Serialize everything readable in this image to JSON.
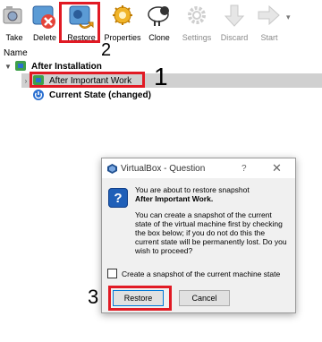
{
  "toolbar": {
    "buttons": [
      {
        "label": "Take",
        "icon": "take-snapshot-icon",
        "enabled": true
      },
      {
        "label": "Delete",
        "icon": "delete-snapshot-icon",
        "enabled": true
      },
      {
        "label": "Restore",
        "icon": "restore-snapshot-icon",
        "enabled": true
      },
      {
        "label": "Properties",
        "icon": "properties-icon",
        "enabled": true
      },
      {
        "label": "Clone",
        "icon": "clone-sheep-icon",
        "enabled": true
      },
      {
        "label": "Settings",
        "icon": "settings-gear-icon",
        "enabled": false
      },
      {
        "label": "Discard",
        "icon": "discard-arrow-icon",
        "enabled": false
      },
      {
        "label": "Start",
        "icon": "start-arrow-icon",
        "enabled": false
      }
    ]
  },
  "tree": {
    "column_header": "Name",
    "root": {
      "label": "After Installation",
      "expanded": true
    },
    "child": {
      "label": "After Important Work",
      "selected": true
    },
    "current_state": {
      "label": "Current State (changed)"
    }
  },
  "annotations": {
    "one": "1",
    "two": "2",
    "three": "3"
  },
  "dialog": {
    "title": "VirtualBox - Question",
    "help_glyph": "?",
    "close_glyph": "✕",
    "question_glyph": "?",
    "line1": "You are about to restore snapshot",
    "line2_bold": "After Important Work",
    "line2_end": ".",
    "body": "You can create a snapshot of the current state of the virtual machine first by checking the box below; if you do not do this the current state will be permanently lost. Do you wish to proceed?",
    "checkbox_label": "Create a snapshot of the current machine state",
    "checkbox_checked": false,
    "restore_label": "Restore",
    "cancel_label": "Cancel"
  },
  "colors": {
    "highlight": "#e11a24",
    "vm_green": "#3ea04a",
    "vm_blue": "#2a6fd0"
  }
}
